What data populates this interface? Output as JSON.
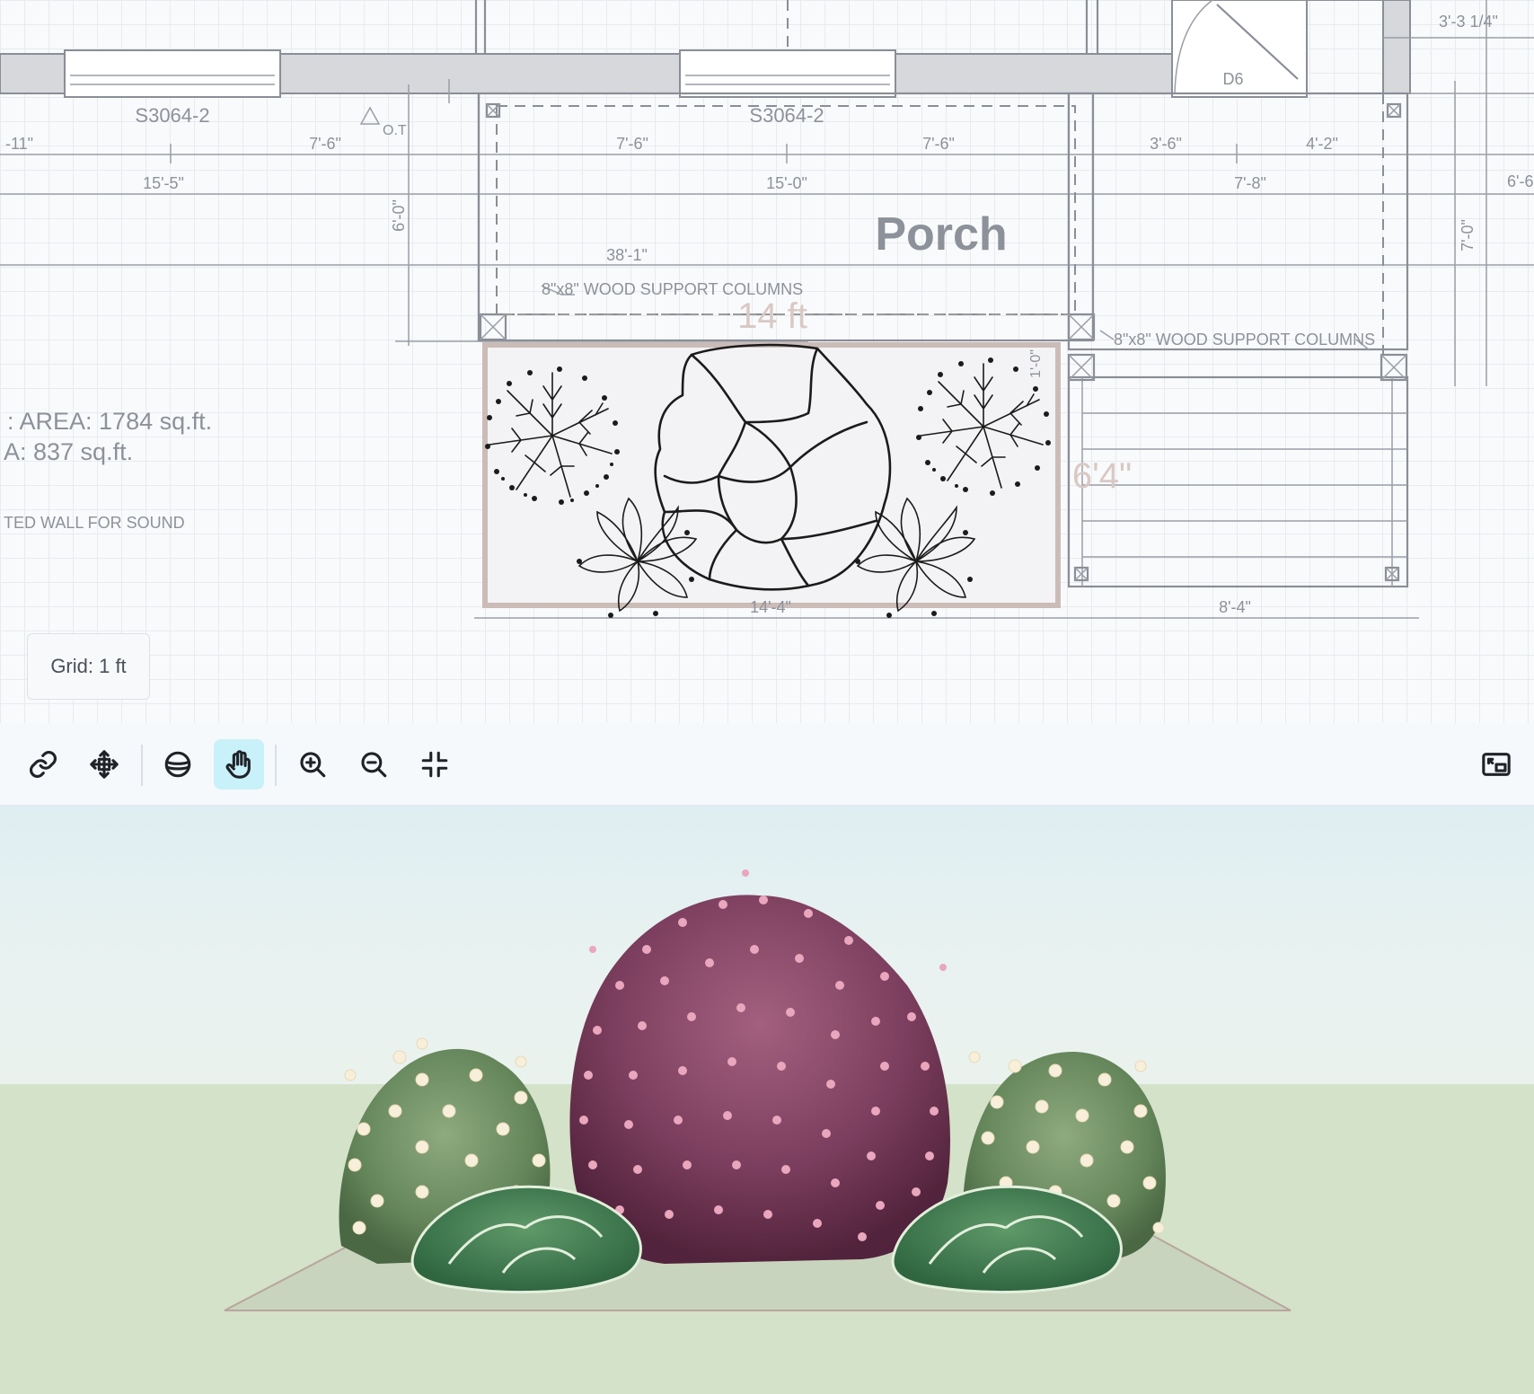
{
  "plan": {
    "room_label": "Porch",
    "window_labels": [
      "S3064-2",
      "S3064-2"
    ],
    "door_label": "D6",
    "ot_label": "O.T",
    "dimensions": {
      "top_left_edge": "-11\"",
      "d1": "7'-6\"",
      "d2": "7'-6\"",
      "d3": "7'-6\"",
      "d4": "3'-6\"",
      "d5": "4'-2\"",
      "d6": "15'-5\"",
      "d7": "15'-0\"",
      "d8": "7'-8\"",
      "right_edge": "6'-6",
      "top_right": "3'-3 1/4\"",
      "vertical_left": "6'-0\"",
      "vertical_right": "7'-0\"",
      "porch_width": "38'-1\"",
      "bed_bottom": "14'-4\"",
      "steps_bottom": "8'-4\"",
      "small_vertical": "1'-0\""
    },
    "column_note_left": "8\"x8\" WOOD SUPPORT COLUMNS",
    "column_note_right": "8\"x8\" WOOD SUPPORT COLUMNS",
    "area_line_1": ": AREA: 1784 sq.ft.",
    "area_line_2": "A: 837 sq.ft.",
    "wall_note": "TED WALL FOR SOUND",
    "bed_width_label": "14 ft",
    "bed_depth_label": "6'4\""
  },
  "grid_badge": "Grid: 1 ft",
  "toolbar": {
    "buttons": [
      {
        "name": "link-button",
        "icon": "link-icon"
      },
      {
        "name": "move-button",
        "icon": "move-arrows-icon"
      },
      {
        "name": "layers-button",
        "icon": "layers-icon"
      },
      {
        "name": "pan-button",
        "icon": "hand-icon",
        "active": true
      },
      {
        "name": "zoom-in-button",
        "icon": "zoom-in-icon"
      },
      {
        "name": "zoom-out-button",
        "icon": "zoom-out-icon"
      },
      {
        "name": "fit-view-button",
        "icon": "collapse-icon"
      },
      {
        "name": "picture-in-picture-button",
        "icon": "picture-in-picture-icon"
      }
    ],
    "active_color": "#c8f1f9"
  },
  "colors": {
    "sky": "#e6f1f1",
    "ground": "#d3e2c8",
    "bed_outline": "#cbbcb8",
    "shrub_green": "#6b8f63",
    "flower_cream": "#f7efd9",
    "tree_purple": "#7c3e5e",
    "blossom_pink": "#e9a6bd",
    "hosta_green": "#3f7a4e"
  }
}
